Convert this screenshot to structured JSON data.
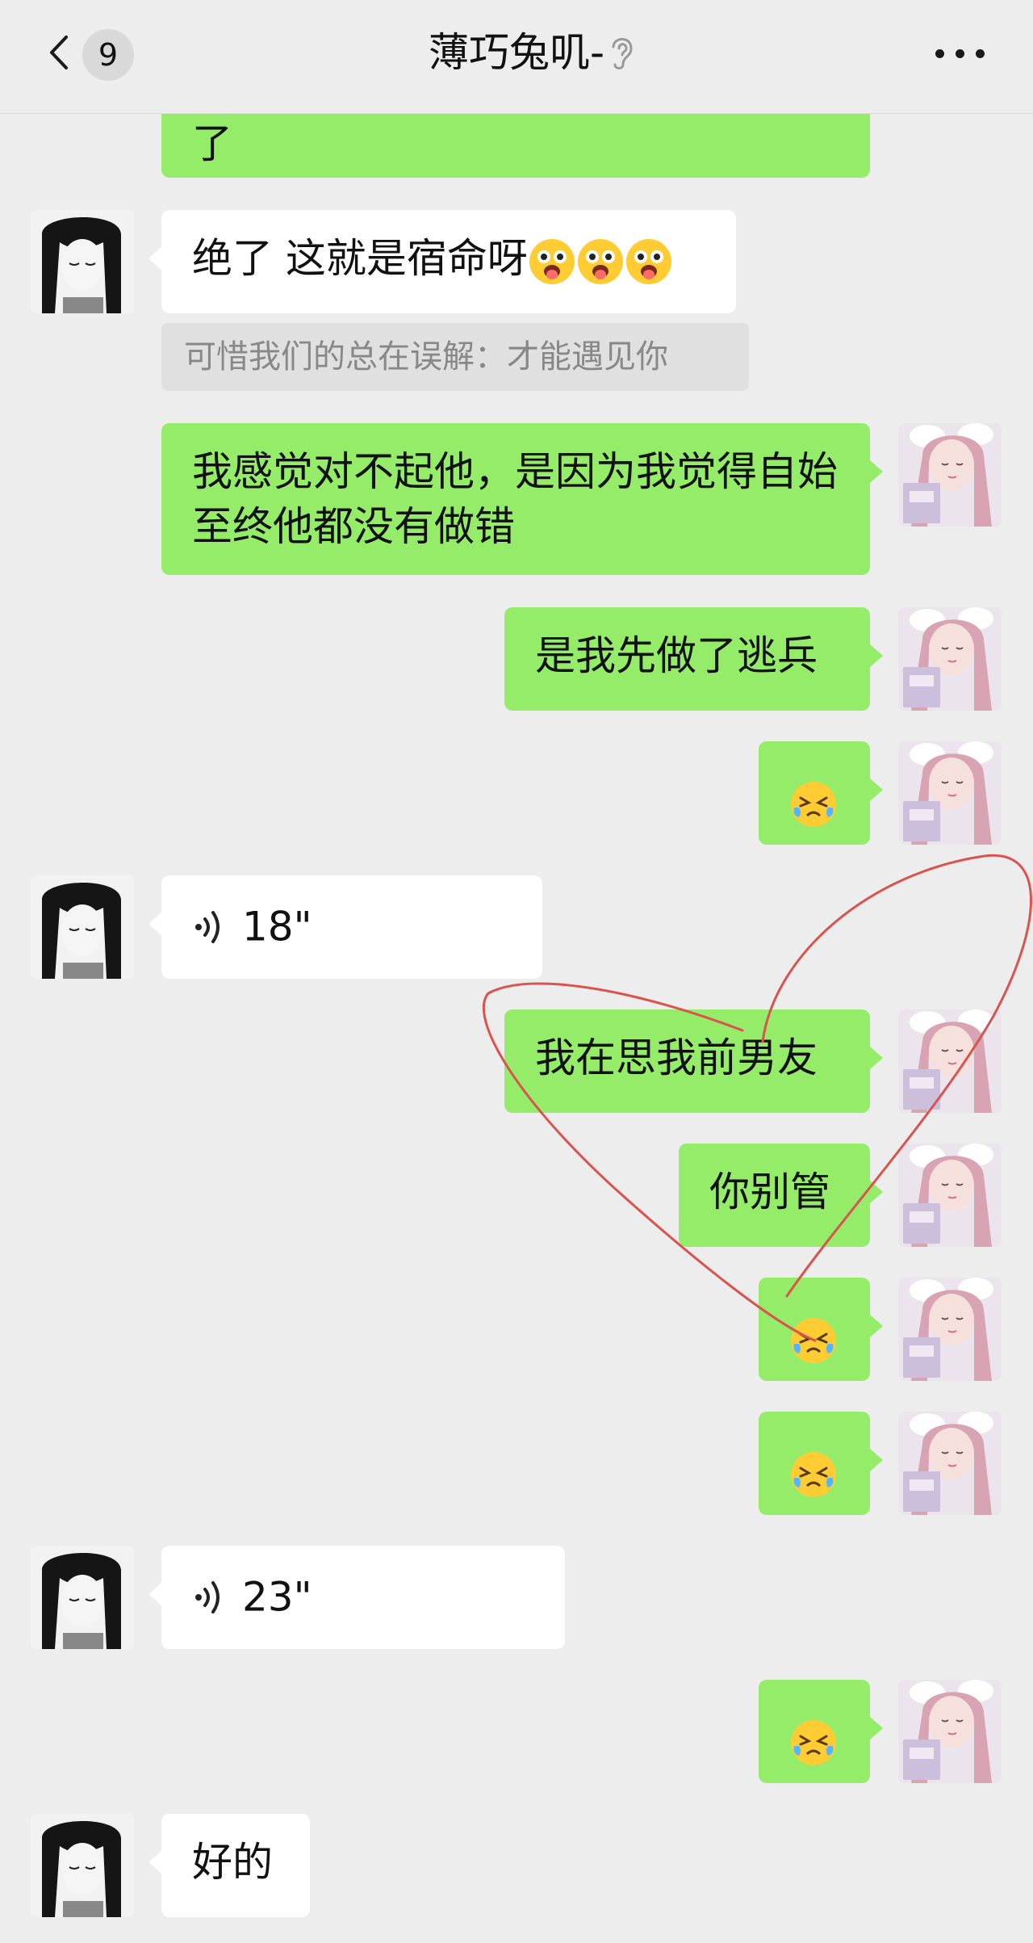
{
  "header": {
    "unread_count": "9",
    "title": "薄巧兔叽-"
  },
  "messages": [
    {
      "side": "sent",
      "text": "了",
      "note": "partially scrolled off top"
    },
    {
      "side": "recv",
      "text": "绝了 这就是宿命呀",
      "emojis": [
        "tongue-out-emoji",
        "tongue-out-emoji",
        "tongue-out-emoji"
      ]
    },
    {
      "side": "quote",
      "text": "可惜我们的总在误解：才能遇见你"
    },
    {
      "side": "sent",
      "text": "我感觉对不起他，是因为我觉得自始至终他都没有做错"
    },
    {
      "side": "sent",
      "text": "是我先做了逃兵"
    },
    {
      "side": "sent",
      "emoji": "crying-face-emoji"
    },
    {
      "side": "recv",
      "voice": "18\""
    },
    {
      "side": "sent",
      "text": "我在思我前男友"
    },
    {
      "side": "sent",
      "text": "你别管"
    },
    {
      "side": "sent",
      "emoji": "crying-face-emoji"
    },
    {
      "side": "sent",
      "emoji": "crying-face-emoji"
    },
    {
      "side": "recv",
      "voice": "23\""
    },
    {
      "side": "sent",
      "emoji": "crying-face-emoji"
    },
    {
      "side": "recv",
      "text": "好的"
    }
  ],
  "colors": {
    "background": "#ededed",
    "sent_bubble": "#95ec69",
    "recv_bubble": "#ffffff",
    "quote_bg": "#e0e0e0",
    "annotation_stroke": "#d9534f"
  },
  "icons": {
    "back": "chevron-left-icon",
    "ear": "ear-icon",
    "more": "more-dots-icon",
    "voice": "voice-wave-icon"
  }
}
